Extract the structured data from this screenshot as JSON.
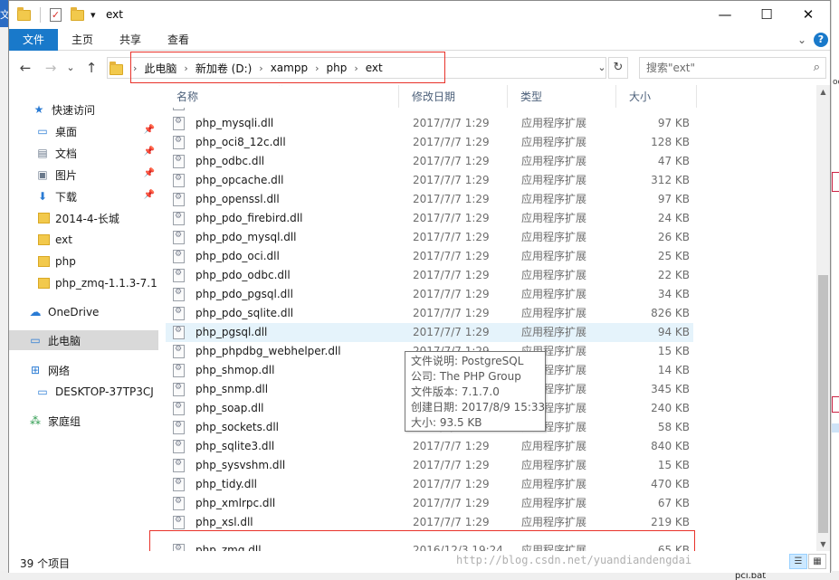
{
  "window": {
    "title": "ext",
    "controls": {
      "minimize": "—",
      "maximize": "☐",
      "close": "✕"
    }
  },
  "quick_access_toolbar": {
    "dropdown": "▾"
  },
  "ribbon": {
    "tabs": [
      "文件",
      "主页",
      "共享",
      "查看"
    ],
    "expand_glyph": "⌄",
    "help_glyph": "?"
  },
  "navigation": {
    "back": "←",
    "forward": "→",
    "recent": "⌄",
    "up": "↑"
  },
  "address_bar": {
    "breadcrumb": [
      "此电脑",
      "新加卷 (D:)",
      "xampp",
      "php",
      "ext"
    ],
    "separator": "›",
    "dropdown": "⌄",
    "refresh": "↻"
  },
  "search": {
    "placeholder": "搜索\"ext\"",
    "icon": "⌕"
  },
  "sidebar": {
    "items": [
      {
        "label": "快速访问",
        "icon": "★",
        "pinned": false
      },
      {
        "label": "桌面",
        "icon": "▭",
        "pinned": true
      },
      {
        "label": "文档",
        "icon": "▤",
        "pinned": true
      },
      {
        "label": "图片",
        "icon": "▣",
        "pinned": true
      },
      {
        "label": "下载",
        "icon": "⬇",
        "pinned": true
      },
      {
        "label": "2014-4-长城",
        "icon": "folder",
        "pinned": false
      },
      {
        "label": "ext",
        "icon": "folder",
        "pinned": false
      },
      {
        "label": "php",
        "icon": "folder",
        "pinned": false
      },
      {
        "label": "php_zmq-1.1.3-7.1",
        "icon": "folder",
        "pinned": false
      },
      {
        "label": "OneDrive",
        "icon": "☁",
        "pinned": false
      },
      {
        "label": "此电脑",
        "icon": "▭",
        "pinned": false,
        "selected": true
      },
      {
        "label": "网络",
        "icon": "⊞",
        "pinned": false
      },
      {
        "label": "DESKTOP-37TP3CJ",
        "icon": "▭",
        "pinned": false
      },
      {
        "label": "家庭组",
        "icon": "⁂",
        "pinned": false
      }
    ],
    "pin_glyph": "📌"
  },
  "columns": {
    "name": "名称",
    "date": "修改日期",
    "type": "类型",
    "size": "大小",
    "sort_glyph": "⌃"
  },
  "files": [
    {
      "name": "php_mysqli.dll",
      "date": "2017/7/7 1:29",
      "type": "应用程序扩展",
      "size": "97 KB"
    },
    {
      "name": "php_oci8_12c.dll",
      "date": "2017/7/7 1:29",
      "type": "应用程序扩展",
      "size": "128 KB"
    },
    {
      "name": "php_odbc.dll",
      "date": "2017/7/7 1:29",
      "type": "应用程序扩展",
      "size": "47 KB"
    },
    {
      "name": "php_opcache.dll",
      "date": "2017/7/7 1:29",
      "type": "应用程序扩展",
      "size": "312 KB"
    },
    {
      "name": "php_openssl.dll",
      "date": "2017/7/7 1:29",
      "type": "应用程序扩展",
      "size": "97 KB"
    },
    {
      "name": "php_pdo_firebird.dll",
      "date": "2017/7/7 1:29",
      "type": "应用程序扩展",
      "size": "24 KB"
    },
    {
      "name": "php_pdo_mysql.dll",
      "date": "2017/7/7 1:29",
      "type": "应用程序扩展",
      "size": "26 KB"
    },
    {
      "name": "php_pdo_oci.dll",
      "date": "2017/7/7 1:29",
      "type": "应用程序扩展",
      "size": "25 KB"
    },
    {
      "name": "php_pdo_odbc.dll",
      "date": "2017/7/7 1:29",
      "type": "应用程序扩展",
      "size": "22 KB"
    },
    {
      "name": "php_pdo_pgsql.dll",
      "date": "2017/7/7 1:29",
      "type": "应用程序扩展",
      "size": "34 KB"
    },
    {
      "name": "php_pdo_sqlite.dll",
      "date": "2017/7/7 1:29",
      "type": "应用程序扩展",
      "size": "826 KB"
    },
    {
      "name": "php_pgsql.dll",
      "date": "2017/7/7 1:29",
      "type": "应用程序扩展",
      "size": "94 KB",
      "hover": true
    },
    {
      "name": "php_phpdbg_webhelper.dll",
      "date": "2017/7/7 1:29",
      "type": "应用程序扩展",
      "size": "15 KB"
    },
    {
      "name": "php_shmop.dll",
      "date": "2017/7/7 1:29",
      "type": "应用程序扩展",
      "size": "14 KB"
    },
    {
      "name": "php_snmp.dll",
      "date": "2017/7/7 1:29",
      "type": "应用程序扩展",
      "size": "345 KB"
    },
    {
      "name": "php_soap.dll",
      "date": "2017/7/7 1:29",
      "type": "应用程序扩展",
      "size": "240 KB"
    },
    {
      "name": "php_sockets.dll",
      "date": "2017/7/7 1:29",
      "type": "应用程序扩展",
      "size": "58 KB"
    },
    {
      "name": "php_sqlite3.dll",
      "date": "2017/7/7 1:29",
      "type": "应用程序扩展",
      "size": "840 KB"
    },
    {
      "name": "php_sysvshm.dll",
      "date": "2017/7/7 1:29",
      "type": "应用程序扩展",
      "size": "15 KB"
    },
    {
      "name": "php_tidy.dll",
      "date": "2017/7/7 1:29",
      "type": "应用程序扩展",
      "size": "470 KB"
    },
    {
      "name": "php_xmlrpc.dll",
      "date": "2017/7/7 1:29",
      "type": "应用程序扩展",
      "size": "67 KB"
    },
    {
      "name": "php_xsl.dll",
      "date": "2017/7/7 1:29",
      "type": "应用程序扩展",
      "size": "219 KB"
    },
    {
      "name": "php_zmq.dll",
      "date": "2016/12/3 19:24",
      "type": "应用程序扩展",
      "size": "65 KB"
    }
  ],
  "tooltip": {
    "lines": [
      "文件说明: PostgreSQL",
      "公司: The PHP Group",
      "文件版本: 7.1.7.0",
      "创建日期: 2017/8/9 15:33",
      "大小: 93.5 KB"
    ]
  },
  "scrollbar": {
    "up": "▲",
    "down": "▼"
  },
  "status": {
    "item_count": "39 个项目"
  },
  "views": {
    "details": "☰",
    "icons": "▦"
  },
  "watermark": "http://blog.csdn.net/yuandiandengdai",
  "background_fragments": {
    "left_title": "文",
    "right_text": "oc",
    "bottom_label": "pci.bat"
  },
  "colors": {
    "accent": "#1979ca",
    "highlight_border": "#e8322a",
    "hover_row": "#e5f3fb",
    "selected_nav": "#d9d9d9"
  }
}
